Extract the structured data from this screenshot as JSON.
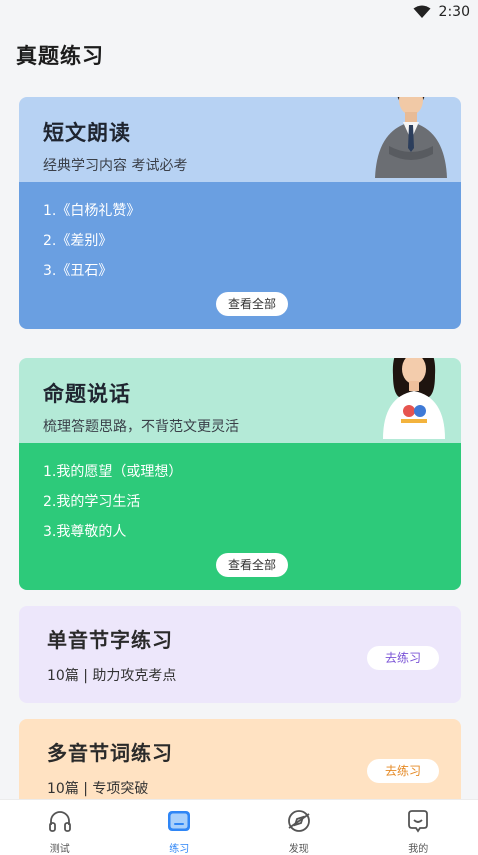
{
  "status": {
    "time": "2:30",
    "icons": [
      "wifi-icon"
    ]
  },
  "page": {
    "title": "真题练习"
  },
  "cards": [
    {
      "title": "短文朗读",
      "subtitle": "经典学习内容 考试必考",
      "items": [
        "1.《白杨礼赞》",
        "2.《差别》",
        "3.《丑石》"
      ],
      "button": "查看全部",
      "colors": {
        "top": "#b7d2f3",
        "bottom": "#6a9fe1"
      }
    },
    {
      "title": "命题说话",
      "subtitle": "梳理答题思路，不背范文更灵活",
      "items": [
        "1.我的愿望（或理想）",
        "2.我的学习生活",
        "3.我尊敬的人"
      ],
      "button": "查看全部",
      "colors": {
        "top": "#b4ead7",
        "bottom": "#2dca7a"
      }
    }
  ],
  "practice": [
    {
      "title": "单音节字练习",
      "desc": "10篇 | 助力攻克考点",
      "button": "去练习",
      "color": "#ede7fb",
      "accent": "#7a53d6"
    },
    {
      "title": "多音节词练习",
      "desc": "10篇 | 专项突破",
      "button": "去练习",
      "color": "#ffe2c2",
      "accent": "#e58a26"
    }
  ],
  "tabs": [
    {
      "label": "测试",
      "icon": "headphones-icon",
      "active": false
    },
    {
      "label": "练习",
      "icon": "practice-icon",
      "active": true
    },
    {
      "label": "发现",
      "icon": "compass-icon",
      "active": false
    },
    {
      "label": "我的",
      "icon": "profile-icon",
      "active": false
    }
  ],
  "accent": "#2f86f6"
}
